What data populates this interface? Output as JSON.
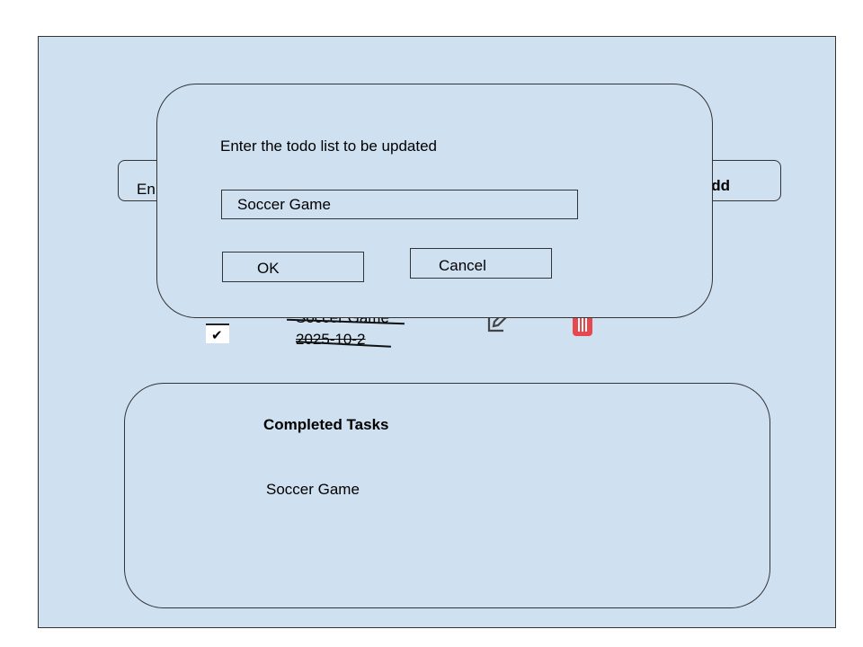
{
  "input_row": {
    "placeholder_visible": "En",
    "add_label": "dd"
  },
  "task": {
    "checked": true,
    "title": "Soccer Game",
    "date": "2025-10-2",
    "edit_icon": "edit-icon",
    "delete_icon": "trash-icon"
  },
  "completed": {
    "title": "Completed Tasks",
    "items": [
      "Soccer Game"
    ]
  },
  "dialog": {
    "prompt": "Enter the todo list to be updated",
    "input_value": "Soccer Game",
    "ok_label": "OK",
    "cancel_label": "Cancel"
  },
  "colors": {
    "background": "#cfe0f1",
    "delete_red": "#e5484d"
  }
}
